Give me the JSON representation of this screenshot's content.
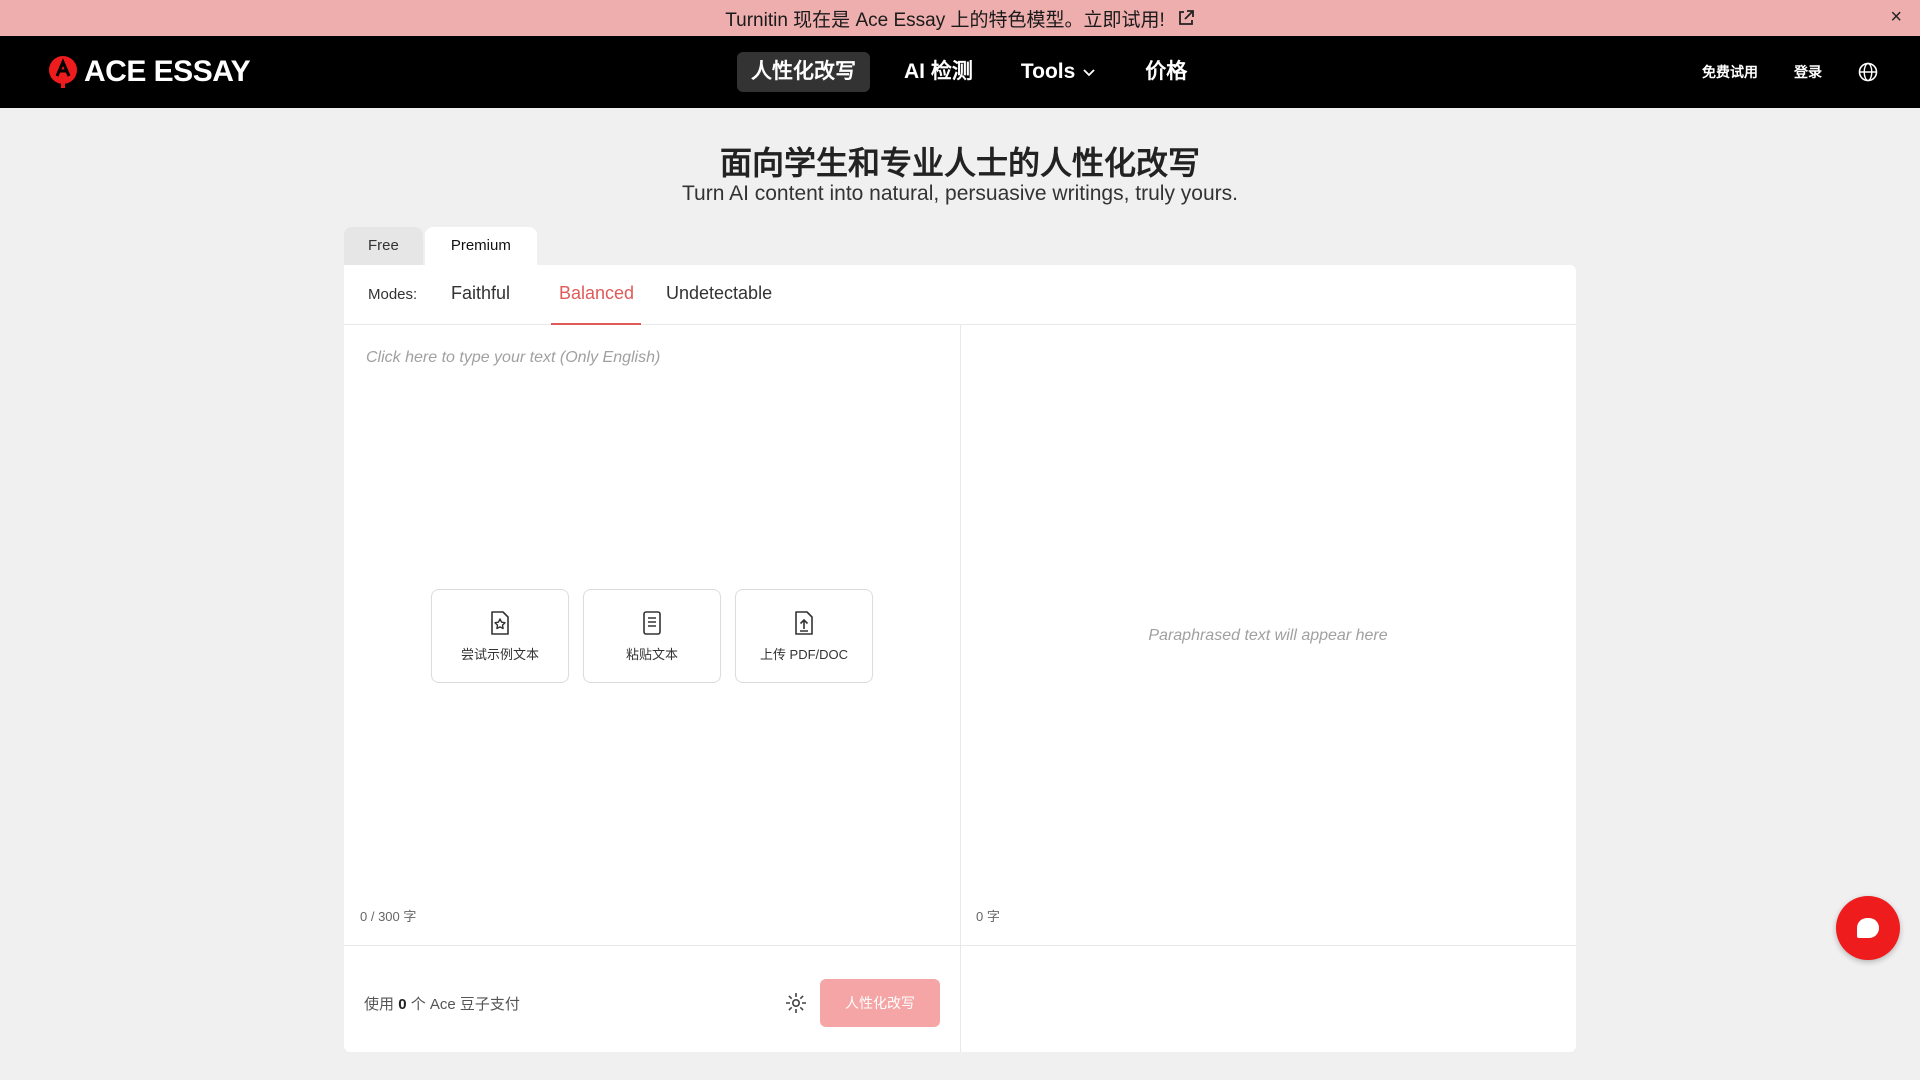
{
  "banner": {
    "text": "Turnitin 现在是 Ace Essay 上的特色模型。立即试用!",
    "close": "×",
    "icons": [
      "external-link-icon",
      "close-icon"
    ]
  },
  "nav": {
    "logo_text": "ACE ESSAY",
    "items": [
      {
        "label": "人性化改写",
        "active": true
      },
      {
        "label": "AI 检测"
      },
      {
        "label": "Tools"
      },
      {
        "label": "价格"
      }
    ],
    "free_trial": "免费试用",
    "login": "登录",
    "icons": [
      "logo-icon",
      "chevron-down-icon",
      "globe-icon"
    ]
  },
  "hero": {
    "title": "面向学生和专业人士的人性化改写",
    "subtitle": "Turn AI content into natural, persuasive writings, truly yours."
  },
  "tabs": [
    {
      "label": "Free"
    },
    {
      "label": "Premium",
      "active": true
    }
  ],
  "modes": {
    "label": "Modes:",
    "items": [
      {
        "label": "Faithful"
      },
      {
        "label": "Balanced",
        "active": true
      },
      {
        "label": "Undetectable"
      }
    ]
  },
  "editor": {
    "placeholder": "Click here to type your text (Only English)",
    "actions": [
      {
        "label": "尝试示例文本",
        "icon": "star-document-icon"
      },
      {
        "label": "粘贴文本",
        "icon": "document-text-icon"
      },
      {
        "label": "上传 PDF/DOC",
        "icon": "upload-document-icon"
      }
    ],
    "count": "0 / 300 字"
  },
  "output": {
    "placeholder": "Paraphrased text will appear here",
    "count": "0 字"
  },
  "footer": {
    "pay_prefix": "使用",
    "pay_amount": "0",
    "pay_suffix": "个 Ace 豆子支付",
    "submit": "人性化改写",
    "icons": [
      "settings-icon",
      "chat-icon"
    ]
  },
  "colors": {
    "accent": "#e05a5a",
    "banner": "#eeaeae",
    "nav_bg": "#000000",
    "submit_disabled": "#f5a5a5",
    "chat": "#ee1c1c"
  }
}
